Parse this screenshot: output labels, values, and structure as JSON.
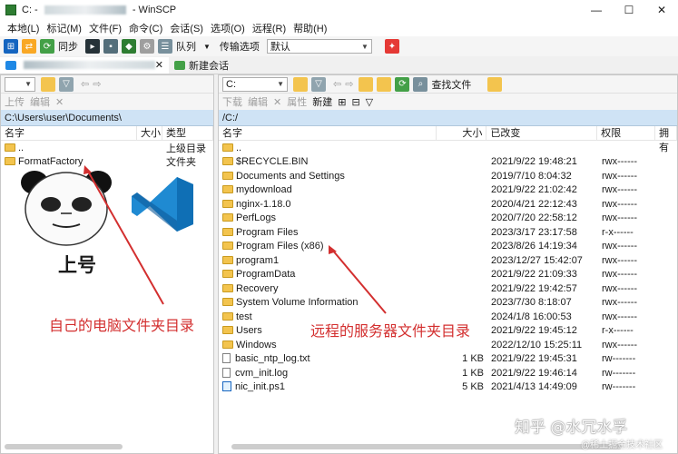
{
  "window": {
    "title_prefix": "C: - ",
    "title_suffix": " - WinSCP",
    "controls": [
      "—",
      "☐",
      "✕"
    ]
  },
  "menu": [
    "本地(L)",
    "标记(M)",
    "文件(F)",
    "命令(C)",
    "会话(S)",
    "选项(O)",
    "远程(R)",
    "帮助(H)"
  ],
  "toolbar": {
    "sync_label": "同步",
    "queue_label": "队列",
    "transfer_label": "传输选项",
    "transfer_value": "默认"
  },
  "tabs": {
    "new_session": "新建会话"
  },
  "left": {
    "drive": "",
    "path": "C:\\Users\\user\\Documents\\",
    "upload": "上传",
    "edit": "编辑",
    "columns": [
      "名字",
      "大小",
      "类型"
    ],
    "rows": [
      {
        "name": "..",
        "size": "",
        "type": "上级目录"
      },
      {
        "name": "FormatFactory",
        "size": "",
        "type": "文件夹"
      }
    ]
  },
  "right": {
    "drive": "C:",
    "find_files": "查找文件",
    "download": "下载",
    "edit": "编辑",
    "properties": "属性",
    "new": "新建",
    "path": "/C:/",
    "columns": [
      "名字",
      "大小",
      "已改变",
      "权限",
      "拥有"
    ],
    "rows": [
      {
        "name": "..",
        "size": "",
        "date": "",
        "perm": "",
        "kind": "up"
      },
      {
        "name": "$RECYCLE.BIN",
        "size": "",
        "date": "2021/9/22 19:48:21",
        "perm": "rwx------",
        "kind": "folder"
      },
      {
        "name": "Documents and Settings",
        "size": "",
        "date": "2019/7/10 8:04:32",
        "perm": "rwx------",
        "kind": "folder"
      },
      {
        "name": "mydownload",
        "size": "",
        "date": "2021/9/22 21:02:42",
        "perm": "rwx------",
        "kind": "folder"
      },
      {
        "name": "nginx-1.18.0",
        "size": "",
        "date": "2020/4/21 22:12:43",
        "perm": "rwx------",
        "kind": "folder"
      },
      {
        "name": "PerfLogs",
        "size": "",
        "date": "2020/7/20 22:58:12",
        "perm": "rwx------",
        "kind": "folder"
      },
      {
        "name": "Program Files",
        "size": "",
        "date": "2023/3/17 23:17:58",
        "perm": "r-x------",
        "kind": "folder"
      },
      {
        "name": "Program Files (x86)",
        "size": "",
        "date": "2023/8/26 14:19:34",
        "perm": "rwx------",
        "kind": "folder"
      },
      {
        "name": "program1",
        "size": "",
        "date": "2023/12/27 15:42:07",
        "perm": "rwx------",
        "kind": "folder"
      },
      {
        "name": "ProgramData",
        "size": "",
        "date": "2021/9/22 21:09:33",
        "perm": "rwx------",
        "kind": "folder"
      },
      {
        "name": "Recovery",
        "size": "",
        "date": "2021/9/22 19:42:57",
        "perm": "rwx------",
        "kind": "folder"
      },
      {
        "name": "System Volume Information",
        "size": "",
        "date": "2023/7/30 8:18:07",
        "perm": "rwx------",
        "kind": "folder"
      },
      {
        "name": "test",
        "size": "",
        "date": "2024/1/8 16:00:53",
        "perm": "rwx------",
        "kind": "folder"
      },
      {
        "name": "Users",
        "size": "",
        "date": "2021/9/22 19:45:12",
        "perm": "r-x------",
        "kind": "folder"
      },
      {
        "name": "Windows",
        "size": "",
        "date": "2022/12/10 15:25:11",
        "perm": "rwx------",
        "kind": "folder"
      },
      {
        "name": "basic_ntp_log.txt",
        "size": "1 KB",
        "date": "2021/9/22 19:45:31",
        "perm": "rw-------",
        "kind": "file"
      },
      {
        "name": "cvm_init.log",
        "size": "1 KB",
        "date": "2021/9/22 19:46:14",
        "perm": "rw-------",
        "kind": "file"
      },
      {
        "name": "nic_init.ps1",
        "size": "5 KB",
        "date": "2021/4/13 14:49:09",
        "perm": "rw-------",
        "kind": "ps1"
      }
    ]
  },
  "annotations": {
    "meme_caption": "上号",
    "left_label": "自己的电脑文件夹目录",
    "right_label": "远程的服务器文件夹目录",
    "watermark": "知乎 @水冗水孚",
    "watermark_sub": "@稀土掘金技术社区"
  }
}
